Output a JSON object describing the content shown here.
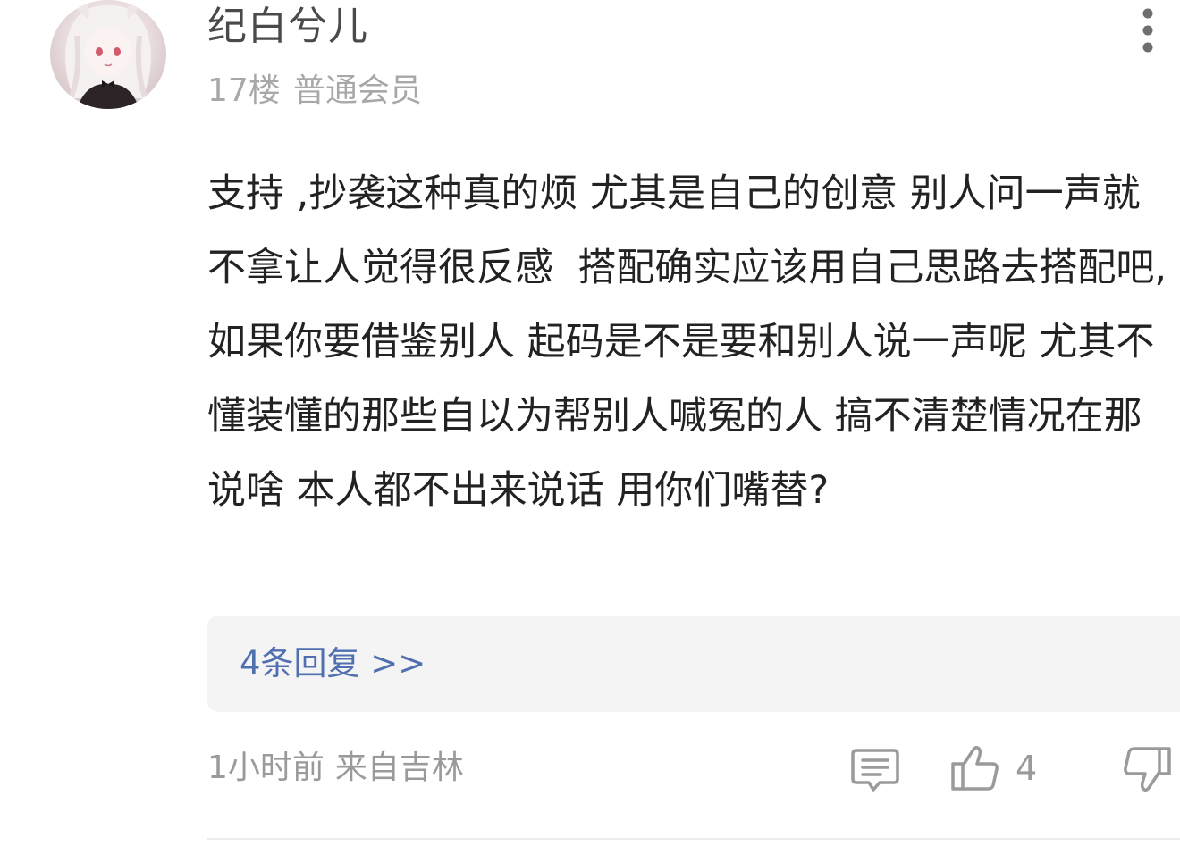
{
  "comment": {
    "user": {
      "name": "纪白兮儿",
      "floor": "17楼",
      "member_level": "普通会员",
      "avatar_icon": "avatar-illustration"
    },
    "more_icon": "more-vertical-icon",
    "text": "支持 ,抄袭这种真的烦 尤其是自己的创意 别人问一声就不拿让人觉得很反感  搭配确实应该用自己思路去搭配吧, 如果你要借鉴别人 起码是不是要和别人说一声呢 尤其不懂装懂的那些自以为帮别人喊冤的人 搞不清楚情况在那说啥 本人都不出来说话 用你们嘴替?",
    "replies_link": "4条回复 >>",
    "time": "1小时前",
    "location": "来自吉林",
    "actions": {
      "reply_icon": "comment-icon",
      "like_icon": "thumbs-up-icon",
      "like_count": "4",
      "dislike_icon": "thumbs-down-icon"
    }
  },
  "colors": {
    "text_primary": "#222222",
    "username": "#4a4a4a",
    "meta": "#a8a8a8",
    "link": "#4f6fb0",
    "reply_box_bg": "#f4f4f4",
    "icon": "#9a9a9a"
  }
}
